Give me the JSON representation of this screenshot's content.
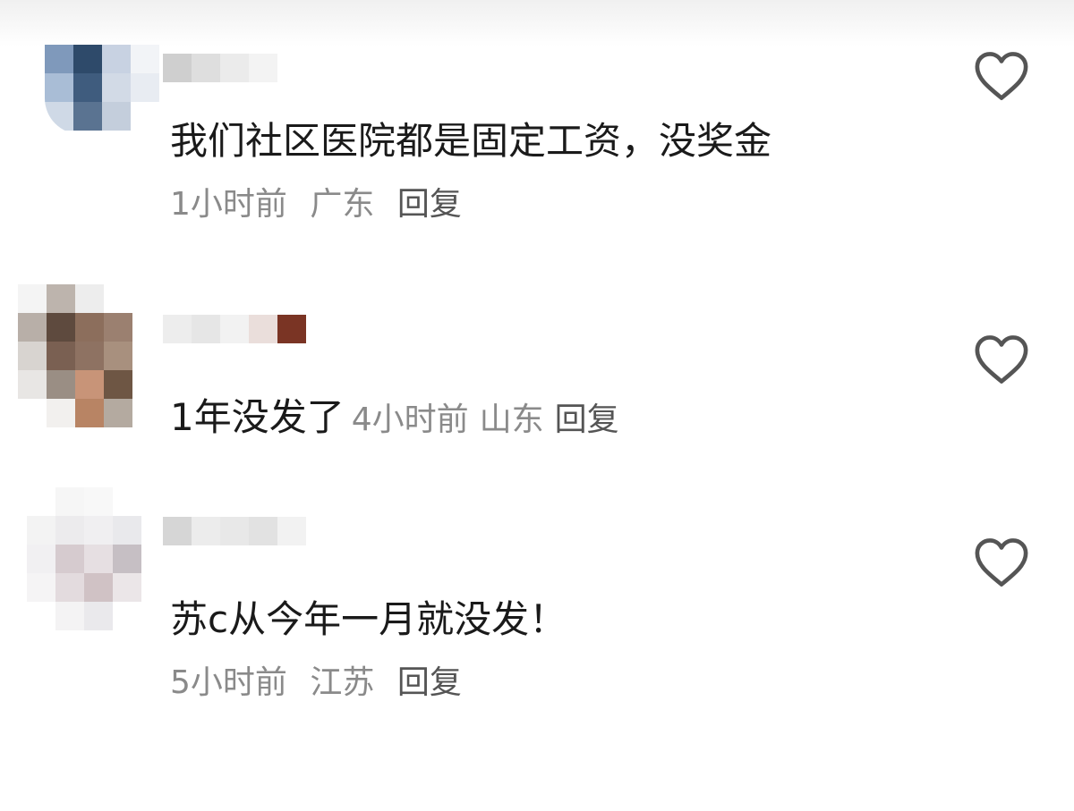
{
  "comments": [
    {
      "text": "我们社区医院都是固定工资，没奖金",
      "time": "1小时前",
      "location": "广东",
      "reply_label": "回复"
    },
    {
      "text": "1年没发了",
      "time": "4小时前",
      "location": "山东",
      "reply_label": "回复"
    },
    {
      "text": "苏c从今年一月就没发！",
      "time": "5小时前",
      "location": "江苏",
      "reply_label": "回复"
    }
  ],
  "icons": {
    "like": "heart-outline-icon",
    "avatar": "pixelated-avatar"
  },
  "colors": {
    "text": "#1a1a1a",
    "meta": "#8a8a8a",
    "icon": "#555555"
  }
}
